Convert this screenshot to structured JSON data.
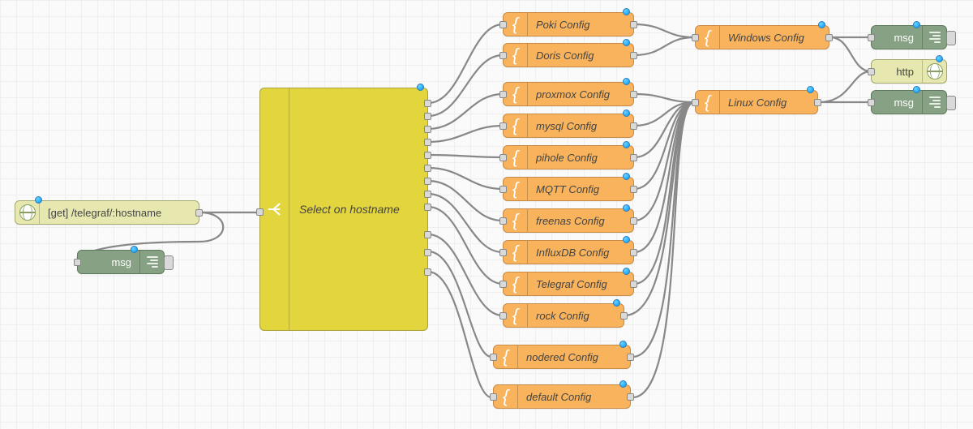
{
  "http_in": {
    "label": "[get] /telegraf/:hostname"
  },
  "debug_left": {
    "label": "msg"
  },
  "switch": {
    "label": "Select on hostname"
  },
  "configs": [
    {
      "label": "Poki Config"
    },
    {
      "label": "Doris Config"
    },
    {
      "label": "proxmox Config"
    },
    {
      "label": "mysql Config"
    },
    {
      "label": "pihole Config"
    },
    {
      "label": "MQTT Config"
    },
    {
      "label": "freenas Config"
    },
    {
      "label": "InfluxDB Config"
    },
    {
      "label": "Telegraf Config"
    },
    {
      "label": "rock Config"
    },
    {
      "label": "nodered Config"
    },
    {
      "label": "default Config"
    }
  ],
  "os_configs": [
    {
      "label": "Windows Config"
    },
    {
      "label": "Linux Config"
    }
  ],
  "debug_top": {
    "label": "msg"
  },
  "http_out": {
    "label": "http"
  },
  "debug_bottom": {
    "label": "msg"
  }
}
